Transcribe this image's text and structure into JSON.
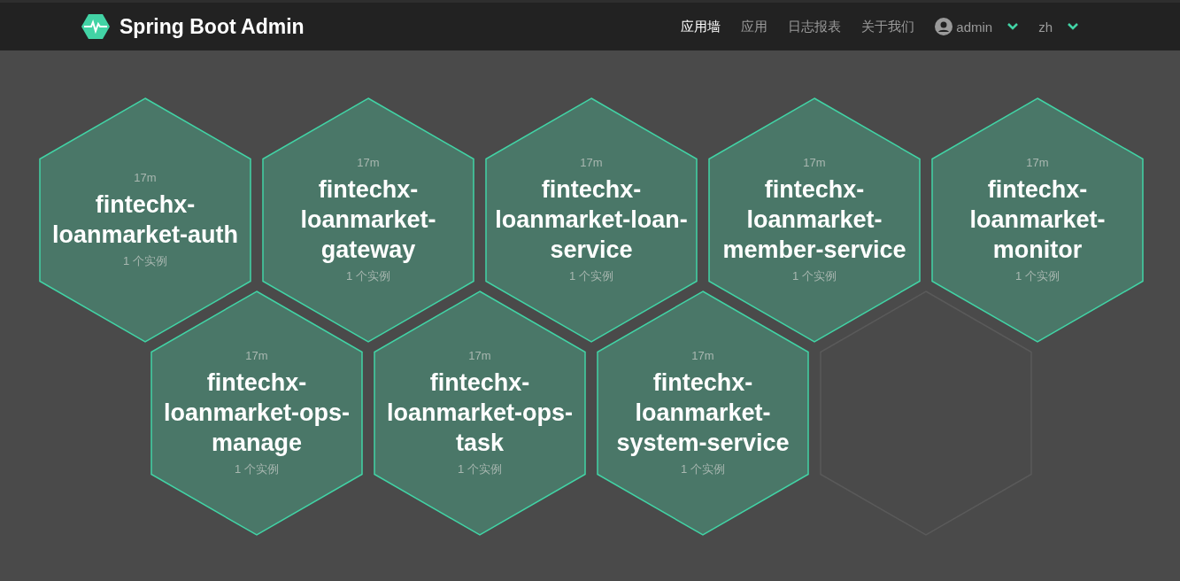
{
  "navbar": {
    "brand": "Spring Boot Admin",
    "items": [
      {
        "label": "应用墙",
        "selected": true
      },
      {
        "label": "应用",
        "selected": false
      },
      {
        "label": "日志报表",
        "selected": false
      },
      {
        "label": "关于我们",
        "selected": false
      }
    ],
    "user": "admin",
    "language": "zh"
  },
  "applications": [
    {
      "uptime": "17m",
      "name": "fintechx-loanmarket-auth",
      "instances": "1 个实例"
    },
    {
      "uptime": "17m",
      "name": "fintechx-loanmarket-gateway",
      "instances": "1 个实例"
    },
    {
      "uptime": "17m",
      "name": "fintechx-loanmarket-loan-service",
      "instances": "1 个实例"
    },
    {
      "uptime": "17m",
      "name": "fintechx-loanmarket-member-service",
      "instances": "1 个实例"
    },
    {
      "uptime": "17m",
      "name": "fintechx-loanmarket-monitor",
      "instances": "1 个实例"
    },
    {
      "uptime": "17m",
      "name": "fintechx-loanmarket-ops-manage",
      "instances": "1 个实例"
    },
    {
      "uptime": "17m",
      "name": "fintechx-loanmarket-ops-task",
      "instances": "1 个实例"
    },
    {
      "uptime": "17m",
      "name": "fintechx-loanmarket-system-service",
      "instances": "1 个实例"
    }
  ]
}
